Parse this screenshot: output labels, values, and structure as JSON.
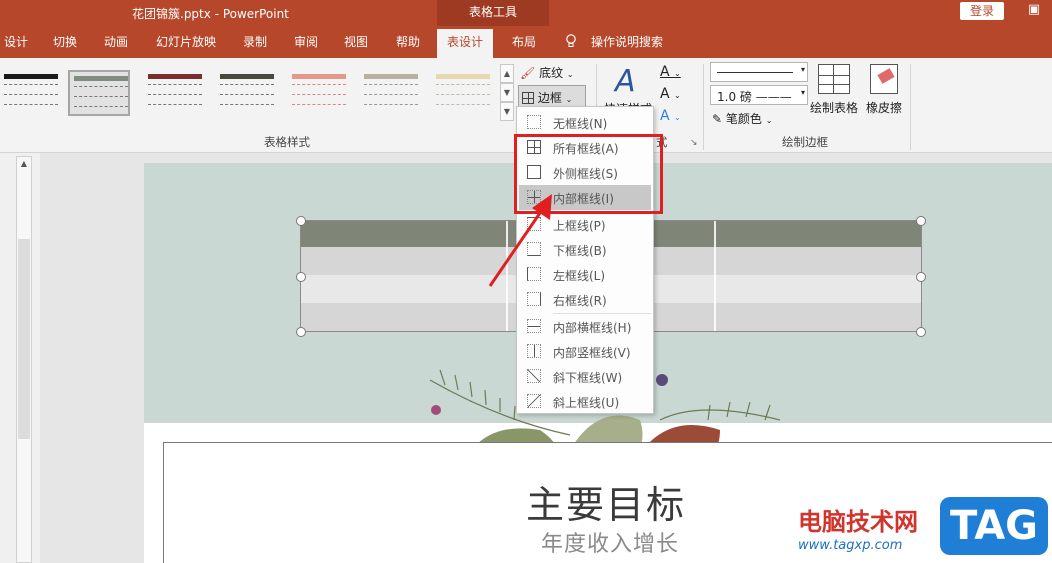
{
  "window": {
    "title": "花团锦簇.pptx  -  PowerPoint",
    "context_tab_group": "表格工具",
    "login": "登录"
  },
  "tabs": [
    {
      "label": "设计"
    },
    {
      "label": "切换"
    },
    {
      "label": "动画"
    },
    {
      "label": "幻灯片放映"
    },
    {
      "label": "录制"
    },
    {
      "label": "审阅"
    },
    {
      "label": "视图"
    },
    {
      "label": "帮助"
    },
    {
      "label": "表设计",
      "active": true
    },
    {
      "label": "布局"
    }
  ],
  "tell_me": "操作说明搜索",
  "ribbon": {
    "table_styles_label": "表格样式",
    "shading": "底纹",
    "borders": "边框",
    "quick_styles": "快速样式",
    "art_styles_suffix": "式",
    "pen_weight": "1.0 磅",
    "pen_color": "笔颜色",
    "draw_table": "绘制表格",
    "eraser": "橡皮擦",
    "draw_borders_label": "绘制边框",
    "gallery_colors": [
      "#1a1a1a",
      "#7f8c7f",
      "#7a2e2e",
      "#4a4a3a",
      "#e39a8a",
      "#b8b0a0",
      "#e8d8b0"
    ]
  },
  "border_menu": {
    "items": [
      {
        "label": "无框线(N)",
        "icon": "no-border-icon"
      },
      {
        "label": "所有框线(A)",
        "icon": "all-borders-icon"
      },
      {
        "label": "外侧框线(S)",
        "icon": "outside-borders-icon"
      },
      {
        "label": "内部框线(I)",
        "icon": "inside-borders-icon",
        "highlighted": true
      },
      {
        "label": "上框线(P)",
        "icon": "top-border-icon"
      },
      {
        "label": "下框线(B)",
        "icon": "bottom-border-icon"
      },
      {
        "label": "左框线(L)",
        "icon": "left-border-icon"
      },
      {
        "label": "右框线(R)",
        "icon": "right-border-icon"
      },
      {
        "label": "内部横框线(H)",
        "icon": "inside-horizontal-border-icon"
      },
      {
        "label": "内部竖框线(V)",
        "icon": "inside-vertical-border-icon"
      },
      {
        "label": "斜下框线(W)",
        "icon": "diagonal-down-border-icon"
      },
      {
        "label": "斜上框线(U)",
        "icon": "diagonal-up-border-icon"
      }
    ]
  },
  "slide": {
    "title": "主要目标",
    "subtitle": "年度收入增长"
  },
  "watermark": {
    "text": "电脑技术网",
    "url": "www.tagxp.com",
    "badge": "TAG"
  },
  "colors": {
    "accent": "#b7472a",
    "highlight_box": "#e02020",
    "table_header": "#7f8678",
    "table_row_light": "#e8e8e8",
    "table_row_dark": "#d4d4d4"
  }
}
